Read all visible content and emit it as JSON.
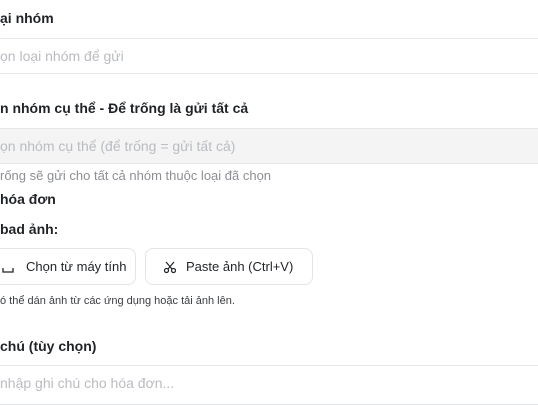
{
  "group_type": {
    "label": "ại nhóm",
    "placeholder": "ọn loại nhóm để gửi"
  },
  "specific_group": {
    "label": "n nhóm cụ thể - Để trống là gửi tất cả",
    "placeholder": "ọn nhóm cụ thể (để trống = gửi tất cả)",
    "hint": "rống sẽ gửi cho tất cả nhóm thuộc loại đã chọn"
  },
  "invoice": {
    "section_title": "hóa đơn",
    "upload_label": "bad ảnh:",
    "choose_button": "Chọn từ máy tính",
    "paste_button": "Paste ảnh (Ctrl+V)",
    "hint": "ó thể dán ảnh từ các ứng dụng hoặc tải ảnh lên."
  },
  "note": {
    "label": "chú (tùy chọn)",
    "placeholder": "nhập ghi chú cho hóa đơn..."
  },
  "icons": {
    "upload": "upload-icon",
    "paste": "scissors-icon"
  }
}
